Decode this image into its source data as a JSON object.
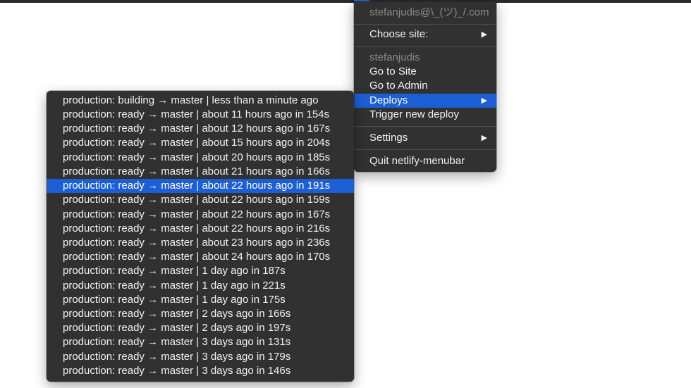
{
  "main_menu": {
    "account": "stefanjudis@\\_(ツ)_/.com",
    "choose_site": "Choose site:",
    "site_name": "stefanjudis",
    "go_to_site": "Go to Site",
    "go_to_admin": "Go to Admin",
    "deploys": "Deploys",
    "trigger_deploy": "Trigger new deploy",
    "settings": "Settings",
    "quit": "Quit netlify-menubar",
    "submenu_arrow": "▶"
  },
  "deploys": [
    "production: building → master | less than a minute ago",
    "production: ready → master | about 11 hours ago in 154s",
    "production: ready → master | about 12 hours ago in 167s",
    "production: ready → master | about 15 hours ago in 204s",
    "production: ready → master | about 20 hours ago in 185s",
    "production: ready → master | about 21 hours ago in 166s",
    "production: ready → master | about 22 hours ago in 191s",
    "production: ready → master | about 22 hours ago in 159s",
    "production: ready → master | about 22 hours ago in 167s",
    "production: ready → master | about 22 hours ago in 216s",
    "production: ready → master | about 23 hours ago in 236s",
    "production: ready → master | about 24 hours ago in 170s",
    "production: ready → master | 1 day ago in 187s",
    "production: ready → master | 1 day ago in 221s",
    "production: ready → master | 1 day ago in 175s",
    "production: ready → master | 2 days ago in 166s",
    "production: ready → master | 2 days ago in 197s",
    "production: ready → master | 3 days ago in 131s",
    "production: ready → master | 3 days ago in 179s",
    "production: ready → master | 3 days ago in 146s"
  ],
  "colors": {
    "menu_background": "#313131",
    "highlight": "#1c5ed6",
    "disabled_text": "#8a8a8a",
    "text": "#f2f2f2"
  }
}
